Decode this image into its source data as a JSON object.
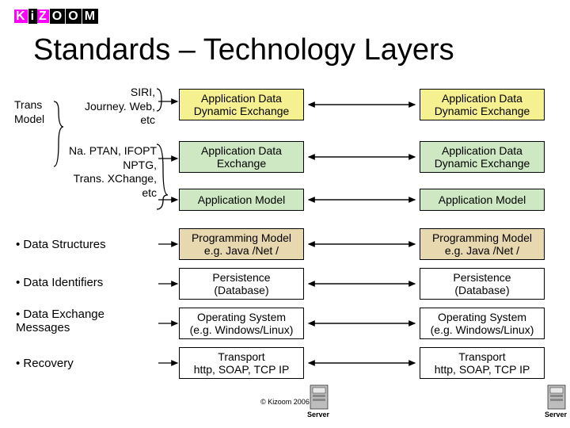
{
  "brand": "KiZOOM",
  "title": "Standards  – Technology Layers",
  "left": {
    "trans_model": "Trans\nModel",
    "siri": "SIRI,\nJourney. Web,\netc",
    "naptan": "Na. PTAN, IFOPT\nNPTG,\nTrans. XChange,\netc",
    "b1": "• Data Structures",
    "b2": "• Data Identifiers",
    "b3": "• Data Exchange\nMessages",
    "b4": "• Recovery"
  },
  "rows": {
    "r1": "Application Data\nDynamic Exchange",
    "r2a": "Application Data\nExchange",
    "r2b": "Application Data\nDynamic Exchange",
    "r3": "Application Model",
    "r4": "Programming Model\ne.g. Java /Net /",
    "r5": "Persistence\n(Database)",
    "r6": "Operating System\n(e.g. Windows/Linux)",
    "r7": "Transport\nhttp, SOAP, TCP IP"
  },
  "colors": {
    "yellow": "#f5f090",
    "green": "#cfe8c4",
    "tan": "#e8d8b0",
    "white": "#ffffff"
  },
  "server_label": "Server",
  "footer": "© Kizoom 2006"
}
